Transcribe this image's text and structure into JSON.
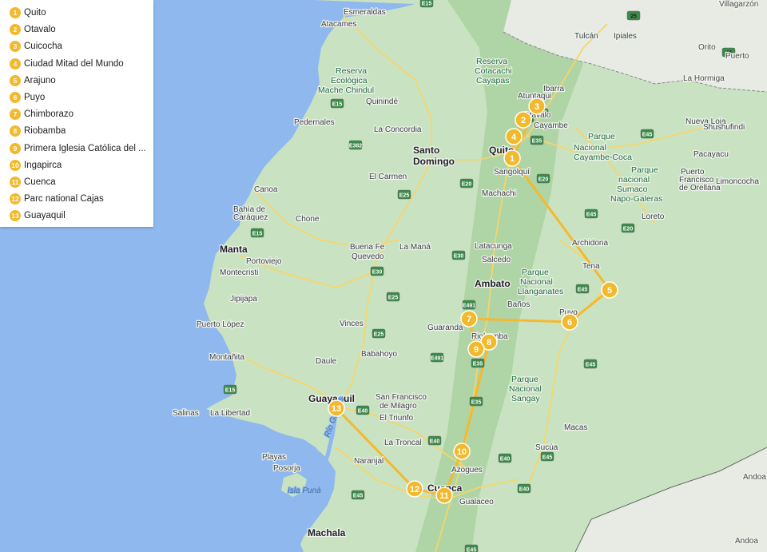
{
  "legend": {
    "items": [
      {
        "num": "1",
        "label": "Quito"
      },
      {
        "num": "2",
        "label": "Otavalo"
      },
      {
        "num": "3",
        "label": "Cuicocha"
      },
      {
        "num": "4",
        "label": "Ciudad Mitad del Mundo"
      },
      {
        "num": "5",
        "label": "Arajuno"
      },
      {
        "num": "6",
        "label": "Puyo"
      },
      {
        "num": "7",
        "label": "Chimborazo"
      },
      {
        "num": "8",
        "label": "Riobamba"
      },
      {
        "num": "9",
        "label": "Primera Iglesia Católica del ..."
      },
      {
        "num": "10",
        "label": "Ingapirca"
      },
      {
        "num": "11",
        "label": "Cuenca"
      },
      {
        "num": "12",
        "label": "Parc national Cajas"
      },
      {
        "num": "13",
        "label": "Guayaquil"
      }
    ]
  },
  "map": {
    "colors": {
      "water": "#8fb8ef",
      "land": "#c9e3c2",
      "lowland": "#b5d8ad",
      "route": "#f5b82e",
      "marker": "#f2b92c"
    },
    "cities": [
      {
        "name": "Quito",
        "major": true
      },
      {
        "name": "Santo",
        "major": true
      },
      {
        "name": "Domingo",
        "major": true
      },
      {
        "name": "Manta",
        "major": true
      },
      {
        "name": "Ambato",
        "major": true
      },
      {
        "name": "Guayaquil",
        "major": true
      },
      {
        "name": "Cuenca",
        "major": true
      },
      {
        "name": "Machala",
        "major": true
      },
      {
        "name": "Esmeraldas"
      },
      {
        "name": "Atacames"
      },
      {
        "name": "Pedernales"
      },
      {
        "name": "Quinindé"
      },
      {
        "name": "La Concordia"
      },
      {
        "name": "El Carmen"
      },
      {
        "name": "Canoa"
      },
      {
        "name": "Bahía de"
      },
      {
        "name": "Caráquez"
      },
      {
        "name": "Chone"
      },
      {
        "name": "Portoviejo"
      },
      {
        "name": "Montecristi"
      },
      {
        "name": "Jipijapa"
      },
      {
        "name": "Puerto López"
      },
      {
        "name": "Montañita"
      },
      {
        "name": "Salinas"
      },
      {
        "name": "La Libertad"
      },
      {
        "name": "Playas"
      },
      {
        "name": "Posorja"
      },
      {
        "name": "Daule"
      },
      {
        "name": "Babahoyo"
      },
      {
        "name": "Vinces"
      },
      {
        "name": "Quevedo"
      },
      {
        "name": "Buena Fe"
      },
      {
        "name": "La Maná"
      },
      {
        "name": "Guaranda"
      },
      {
        "name": "San Francisco"
      },
      {
        "name": "de Milagro"
      },
      {
        "name": "El Triunfo"
      },
      {
        "name": "La Troncal"
      },
      {
        "name": "Naranjal"
      },
      {
        "name": "Azogues"
      },
      {
        "name": "Gualaceo"
      },
      {
        "name": "Latacunga"
      },
      {
        "name": "Salcedo"
      },
      {
        "name": "Baños"
      },
      {
        "name": "Machachi"
      },
      {
        "name": "Sangolquí"
      },
      {
        "name": "Cayambe"
      },
      {
        "name": "Otavalo"
      },
      {
        "name": "Atuntaqui"
      },
      {
        "name": "Ibarra"
      },
      {
        "name": "Tulcán"
      },
      {
        "name": "Ipiales"
      },
      {
        "name": "Archidona"
      },
      {
        "name": "Tena"
      },
      {
        "name": "Macas"
      },
      {
        "name": "Sucúa"
      },
      {
        "name": "Nueva Loja"
      },
      {
        "name": "Shushufindi"
      },
      {
        "name": "Pacayacu"
      },
      {
        "name": "Puerto"
      },
      {
        "name": "Francisco"
      },
      {
        "name": "de Orellana"
      },
      {
        "name": "Limoncocha"
      },
      {
        "name": "Loreto"
      },
      {
        "name": "Riobamba"
      },
      {
        "name": "Puyo"
      }
    ],
    "parks": [
      {
        "name": "Reserva"
      },
      {
        "name": "Ecológica"
      },
      {
        "name": "Mache Chindul"
      },
      {
        "name": "Reserva"
      },
      {
        "name": "Cotacachi"
      },
      {
        "name": "Cayapas"
      },
      {
        "name": "Parque"
      },
      {
        "name": "Nacional"
      },
      {
        "name": "Cayambe-Coca"
      },
      {
        "name": "Parque"
      },
      {
        "name": "nacional"
      },
      {
        "name": "Sumaco"
      },
      {
        "name": "Napo-Galeras"
      },
      {
        "name": "Parque"
      },
      {
        "name": "Nacional"
      },
      {
        "name": "Llanganates"
      },
      {
        "name": "Parque"
      },
      {
        "name": "Nacional"
      },
      {
        "name": "Sangay"
      }
    ],
    "neighbors": [
      {
        "name": "Villagarzón"
      },
      {
        "name": "Orito"
      },
      {
        "name": "La Hormiga"
      },
      {
        "name": "Puerto"
      },
      {
        "name": "Andoa"
      },
      {
        "name": "Andoa"
      }
    ],
    "water_labels": [
      {
        "name": "Isla Puná"
      },
      {
        "name": "Río Guayas"
      }
    ],
    "shields": [
      "E15",
      "E15",
      "E15",
      "E15",
      "E382",
      "E25",
      "E20",
      "E20",
      "E30",
      "E30",
      "E25",
      "E25",
      "E491",
      "E491",
      "E35",
      "E35",
      "E35",
      "E40",
      "E40",
      "E40",
      "E40",
      "E45",
      "E45",
      "E45",
      "E45",
      "E45",
      "E45",
      "E20",
      "E10",
      "25",
      "45",
      "E35",
      "E45"
    ],
    "markers": [
      {
        "num": "1",
        "label": "Quito"
      },
      {
        "num": "2",
        "label": "Otavalo"
      },
      {
        "num": "3",
        "label": "Cuicocha"
      },
      {
        "num": "4",
        "label": "Ciudad Mitad del Mundo"
      },
      {
        "num": "5",
        "label": "Arajuno"
      },
      {
        "num": "6",
        "label": "Puyo"
      },
      {
        "num": "7",
        "label": "Chimborazo"
      },
      {
        "num": "8",
        "label": "Riobamba"
      },
      {
        "num": "9",
        "label": "Primera Iglesia Católica"
      },
      {
        "num": "10",
        "label": "Ingapirca"
      },
      {
        "num": "11",
        "label": "Cuenca"
      },
      {
        "num": "12",
        "label": "Parc national Cajas"
      },
      {
        "num": "13",
        "label": "Guayaquil"
      }
    ]
  }
}
